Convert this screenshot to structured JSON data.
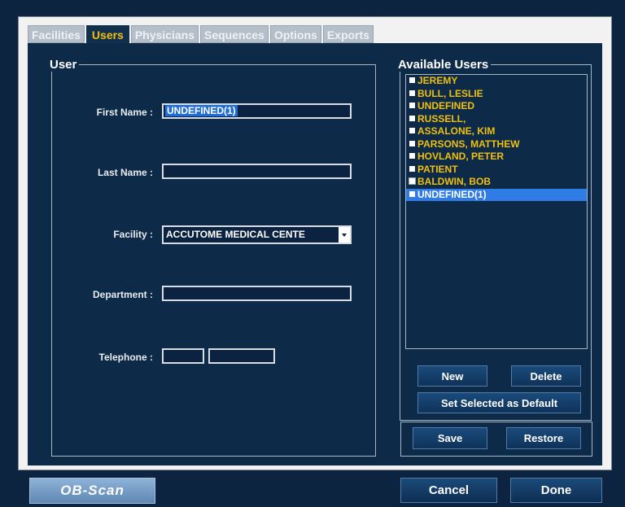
{
  "tabs": [
    "Facilities",
    "Users",
    "Physicians",
    "Sequences",
    "Options",
    "Exports"
  ],
  "active_tab": "Users",
  "user_group": {
    "title": "User",
    "first_name_label": "First Name :",
    "first_name_value": "UNDEFINED(1)",
    "last_name_label": "Last Name :",
    "last_name_value": "",
    "facility_label": "Facility :",
    "facility_value": "ACCUTOME MEDICAL CENTE",
    "department_label": "Department :",
    "department_value": "",
    "telephone_label": "Telephone :",
    "telephone_area": "",
    "telephone_number": ""
  },
  "available_users": {
    "title": "Available Users",
    "items": [
      {
        "name": "JEREMY",
        "default": false
      },
      {
        "name": "BULL, LESLIE",
        "default": false
      },
      {
        "name": "UNDEFINED",
        "default": false
      },
      {
        "name": "RUSSELL,",
        "default": false
      },
      {
        "name": "ASSALONE, KIM",
        "default": false
      },
      {
        "name": "PARSONS, MATTHEW",
        "default": false
      },
      {
        "name": "HOVLAND, PETER",
        "default": false
      },
      {
        "name": "PATIENT",
        "default": false
      },
      {
        "name": "BALDWIN, BOB",
        "default": true
      },
      {
        "name": "UNDEFINED(1)",
        "default": false,
        "selected": true
      }
    ],
    "new_label": "New",
    "delete_label": "Delete",
    "set_default_label": "Set Selected as Default"
  },
  "save_label": "Save",
  "restore_label": "Restore",
  "cancel_label": "Cancel",
  "done_label": "Done",
  "logo_text": "OB-Scan",
  "colors": {
    "background": "#0c2440",
    "panel": "#0d2a48",
    "accent_text": "#f0c010",
    "selection": "#2f7ce6"
  }
}
